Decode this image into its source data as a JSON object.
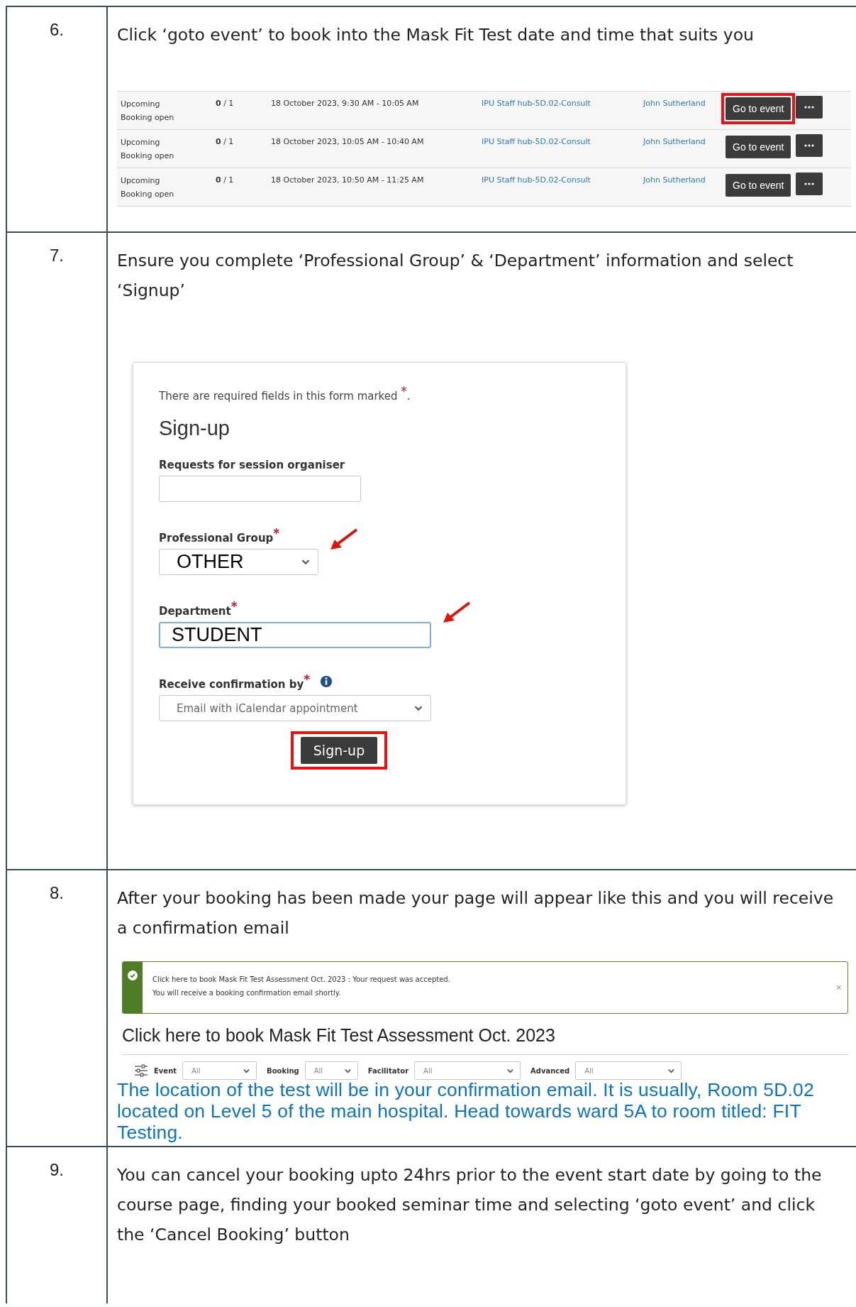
{
  "steps": [
    {
      "number": "6.",
      "kind": "events",
      "text": "Click ‘goto event’ to book into the Mask Fit Test date and time that suits you",
      "events": [
        {
          "status": "Upcoming",
          "booking": "Booking open",
          "count": "**0** / 1",
          "time": "18 October 2023, 9:30 AM - 10:05 AM",
          "location": "IPU Staff hub-5D.02-Consult",
          "facilitator": "John Sutherland",
          "button": "Go to event",
          "highlighted": true
        },
        {
          "status": "Upcoming",
          "booking": "Booking open",
          "count": "**0** / 1",
          "time": "18 October 2023, 10:05 AM - 10:40 AM",
          "location": "IPU Staff hub-5D.02-Consult",
          "facilitator": "John Sutherland",
          "button": "Go to event",
          "highlighted": false
        },
        {
          "status": "Upcoming",
          "booking": "Booking open",
          "count": "**0** / 1",
          "time": "18 October 2023, 10:50 AM - 11:25 AM",
          "location": "IPU Staff hub-5D.02-Consult",
          "facilitator": "John Sutherland",
          "button": "Go to event",
          "highlighted": false
        }
      ]
    },
    {
      "number": "7.",
      "kind": "form",
      "text": "Ensure you complete ‘Professional Group’ & ‘Department’ information and select ‘Signup’",
      "form": {
        "notice": "There are required fields in this form marked $^{*}$.",
        "title": "Sign-up",
        "fields": [
          {
            "kind": "input",
            "label": "Requests for session organiser",
            "pointer": false,
            "focused": false
          },
          {
            "kind": "select",
            "label": "Professional Group$^{*}$",
            "value": "OTHER",
            "pointer": true,
            "focused": false
          },
          {
            "kind": "input",
            "label": "Department$^{*}$",
            "value": "STUDENT",
            "pointer": true,
            "focused": true
          },
          {
            "kind": "select",
            "label": "Receive confirmation by$^{*}$",
            "info": true,
            "value": "Email with iCalendar appointment",
            "pointer": false,
            "focused": false
          }
        ],
        "submit": {
          "label": "Sign-up",
          "highlighted": true
        }
      }
    },
    {
      "number": "8.",
      "kind": "confirmation",
      "text": "After your booking has been made your page will appear like this and you will receive a confirmation email",
      "alert": {
        "lines": [
          "Click here to book Mask Fit Test Assessment Oct. 2023 : Your request was accepted.",
          "You will receive a booking confirmation email shortly."
        ],
        "close": "×"
      },
      "heading": "Click here to book Mask Fit Test Assessment Oct. 2023",
      "filters": [
        {
          "label": "Event",
          "placeholder": "All"
        },
        {
          "label": "Booking",
          "placeholder": "All"
        },
        {
          "label": "Facilitator",
          "placeholder": "All"
        },
        {
          "label": "Advanced",
          "placeholder": "All"
        }
      ],
      "note": "The location of the test will be in your confirmation email. It is usually, Room 5D.02 located on Level 5 of the main hospital. Head towards ward 5A to room titled: FIT Testing."
    },
    {
      "number": "9.",
      "kind": "text",
      "text": "You can cancel your booking upto 24hrs prior to the event start date by going to the course page, finding your booked seminar time and selecting ‘goto event’ and click the ‘Cancel Booking’ button"
    }
  ]
}
